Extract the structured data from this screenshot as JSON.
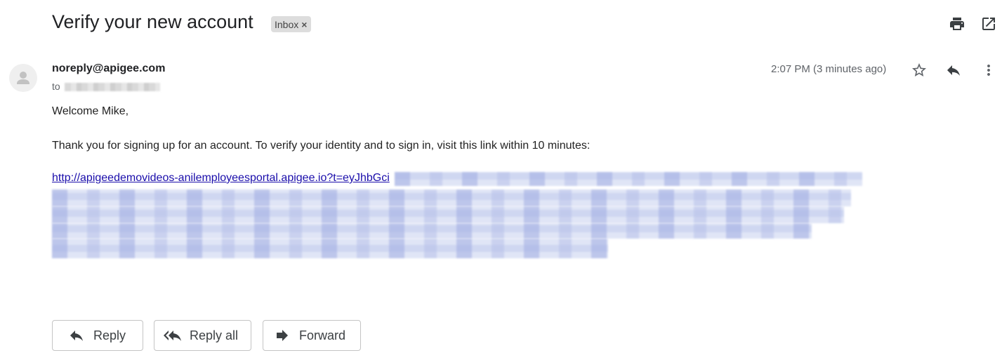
{
  "email": {
    "subject": "Verify your new account",
    "label_chip": "Inbox",
    "label_close": "×",
    "sender": "noreply@apigee.com",
    "to_label": "to",
    "timestamp": "2:07 PM (3 minutes ago)",
    "greeting": "Welcome Mike,",
    "message": "Thank you for signing up for an account. To verify your identity and to sign in, visit this link within 10 minutes:",
    "link_visible": "http://apigeedemovideos-anilemployeesportal.apigee.io?t=eyJhbGci"
  },
  "icons": {
    "print": "print-icon",
    "open_new_window": "open-in-new-window-icon",
    "star": "star-icon",
    "reply": "reply-icon",
    "more": "more-vert-icon",
    "reply_all": "reply-all-icon",
    "forward": "forward-icon",
    "avatar": "person-icon"
  },
  "buttons": {
    "reply": "Reply",
    "reply_all": "Reply all",
    "forward": "Forward"
  },
  "colors": {
    "link": "#1a0dab",
    "redaction": "#cfd7f1",
    "chip_bg": "#dddddd"
  }
}
